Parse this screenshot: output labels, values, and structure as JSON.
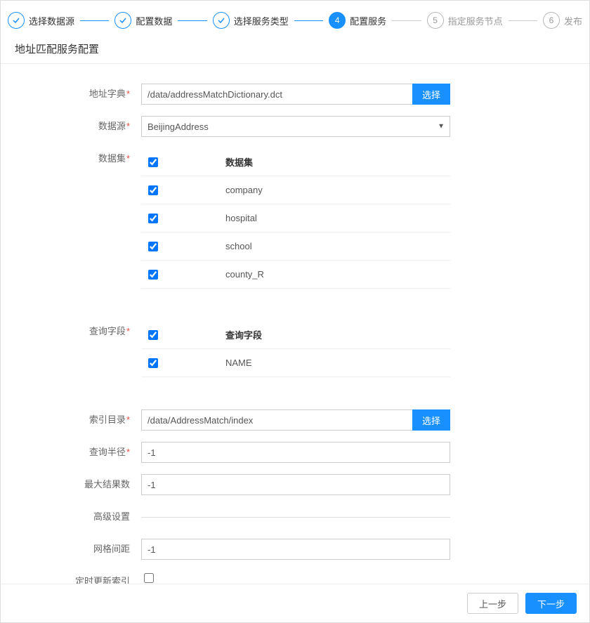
{
  "stepper": {
    "steps": [
      {
        "label": "选择数据源",
        "state": "done"
      },
      {
        "label": "配置数据",
        "state": "done"
      },
      {
        "label": "选择服务类型",
        "state": "done"
      },
      {
        "label": "配置服务",
        "state": "active",
        "num": "4"
      },
      {
        "label": "指定服务节点",
        "state": "pending",
        "num": "5"
      },
      {
        "label": "发布",
        "state": "pending",
        "num": "6"
      }
    ]
  },
  "section_title": "地址匹配服务配置",
  "labels": {
    "address_dict": "地址字典",
    "datasource": "数据源",
    "dataset": "数据集",
    "query_field": "查询字段",
    "index_dir": "索引目录",
    "query_radius": "查询半径",
    "max_results": "最大结果数",
    "advanced": "高级设置",
    "grid_spacing": "网格间距",
    "cron_update": "定时更新索引"
  },
  "fields": {
    "address_dict": "/data/addressMatchDictionary.dct",
    "datasource": "BeijingAddress",
    "index_dir": "/data/AddressMatch/index",
    "query_radius": "-1",
    "max_results": "-1",
    "grid_spacing": "-1",
    "cron_update_checked": false
  },
  "dataset_table": {
    "header": "数据集",
    "rows": [
      {
        "name": "company",
        "checked": true
      },
      {
        "name": "hospital",
        "checked": true
      },
      {
        "name": "school",
        "checked": true
      },
      {
        "name": "county_R",
        "checked": true
      }
    ],
    "header_checked": true
  },
  "query_field_table": {
    "header": "查询字段",
    "rows": [
      {
        "name": "NAME",
        "checked": true
      }
    ],
    "header_checked": true
  },
  "buttons": {
    "choose": "选择",
    "prev": "上一步",
    "next": "下一步"
  }
}
